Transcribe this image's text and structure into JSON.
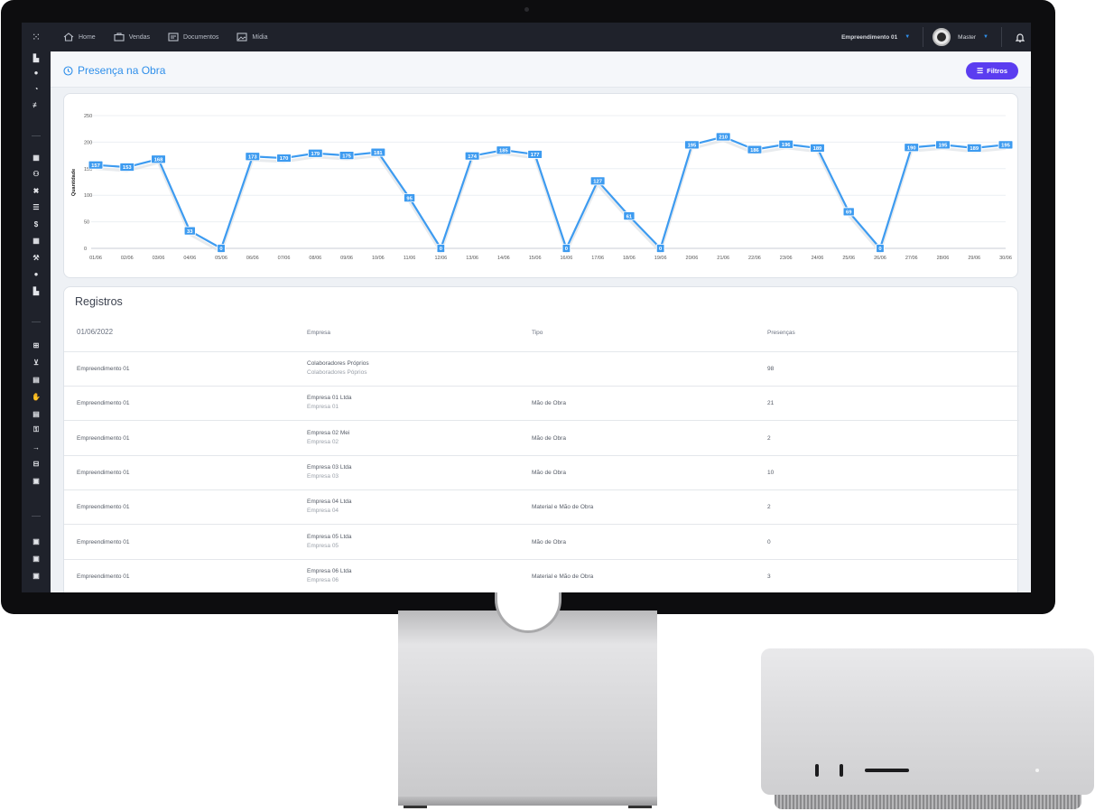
{
  "nav": {
    "items": [
      {
        "label": "Home",
        "icon": "home-icon"
      },
      {
        "label": "Vendas",
        "icon": "briefcase-icon"
      },
      {
        "label": "Documentos",
        "icon": "documents-icon"
      },
      {
        "label": "Mídia",
        "icon": "image-icon"
      }
    ],
    "enterprise": "Empreendimento 01",
    "user": "Master"
  },
  "page": {
    "title": "Presença na Obra",
    "filter_label": "Filtros"
  },
  "chart_data": {
    "type": "line",
    "ylabel": "Quantidade",
    "ylim": [
      0,
      250
    ],
    "yticks": [
      0,
      50,
      100,
      150,
      200,
      250
    ],
    "categories": [
      "01/06",
      "02/06",
      "03/06",
      "04/06",
      "05/06",
      "06/06",
      "07/06",
      "08/06",
      "09/06",
      "10/06",
      "11/06",
      "12/06",
      "13/06",
      "14/06",
      "15/06",
      "16/06",
      "17/06",
      "18/06",
      "19/06",
      "20/06",
      "21/06",
      "22/06",
      "23/06",
      "24/06",
      "25/06",
      "26/06",
      "27/06",
      "28/06",
      "29/06",
      "30/06"
    ],
    "values": [
      157,
      153,
      168,
      33,
      0,
      173,
      170,
      179,
      175,
      181,
      95,
      0,
      174,
      185,
      177,
      0,
      127,
      61,
      0,
      195,
      210,
      186,
      196,
      189,
      69,
      0,
      190,
      195,
      189,
      195
    ],
    "grid": true,
    "color": "#3d9bf0"
  },
  "table": {
    "title": "Registros",
    "date": "01/06/2022",
    "headers": {
      "empresa": "Empresa",
      "tipo": "Tipo",
      "presencas": "Presenças"
    },
    "rows": [
      {
        "emp": "Empreendimento 01",
        "company": "Colaboradores Próprios",
        "company_sub": "Colaboradores Póprios",
        "tipo": "",
        "presencas": "98"
      },
      {
        "emp": "Empreendimento 01",
        "company": "Empresa 01 Ltda",
        "company_sub": "Empresa 01",
        "tipo": "Mão de Obra",
        "presencas": "21"
      },
      {
        "emp": "Empreendimento 01",
        "company": "Empresa 02 Mei",
        "company_sub": "Empresa 02",
        "tipo": "Mão de Obra",
        "presencas": "2"
      },
      {
        "emp": "Empreendimento 01",
        "company": "Empresa 03 Ltda",
        "company_sub": "Empresa 03",
        "tipo": "Mão de Obra",
        "presencas": "10"
      },
      {
        "emp": "Empreendimento 01",
        "company": "Empresa 04 Ltda",
        "company_sub": "Empresa 04",
        "tipo": "Material e Mão de Obra",
        "presencas": "2"
      },
      {
        "emp": "Empreendimento 01",
        "company": "Empresa 05 Ltda",
        "company_sub": "Empresa 05",
        "tipo": "Mão de Obra",
        "presencas": "0"
      },
      {
        "emp": "Empreendimento 01",
        "company": "Empresa 06 Ltda",
        "company_sub": "Empresa 06",
        "tipo": "Material e Mão de Obra",
        "presencas": "3"
      }
    ]
  }
}
